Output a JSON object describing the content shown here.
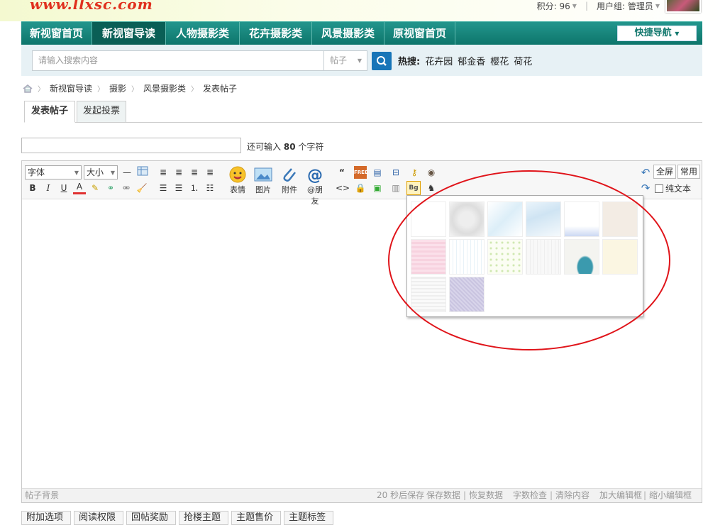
{
  "header": {
    "logo": "www.llxsc.com",
    "points_label": "积分: 96",
    "group_label": "用户组: 管理员"
  },
  "nav": {
    "items": [
      "新视窗首页",
      "新视窗导读",
      "人物摄影类",
      "花卉摄影类",
      "风景摄影类",
      "原视窗首页"
    ],
    "quick": "快捷导航"
  },
  "search": {
    "placeholder": "请输入搜索内容",
    "type": "帖子",
    "hot_label": "热搜:",
    "hot": [
      "花卉园",
      "郁金香",
      "樱花",
      "荷花"
    ]
  },
  "breadcrumb": [
    "新视窗导读",
    "摄影",
    "风景摄影类",
    "发表帖子"
  ],
  "tabs": [
    "发表帖子",
    "发起投票"
  ],
  "title_hint": {
    "prefix": "还可输入",
    "count": "80",
    "suffix": "个字符"
  },
  "toolbar": {
    "font": "字体",
    "size": "大小",
    "big": [
      "表情",
      "图片",
      "附件",
      "@朋友"
    ],
    "fullscreen": "全屏",
    "common": "常用",
    "plaintext": "纯文本",
    "bg": "Bg",
    "free": "FREE"
  },
  "status": {
    "left": "帖子背景",
    "autosave": "20 秒后保存",
    "save": "保存数据",
    "restore": "恢复数据",
    "check": "字数检查",
    "clear": "清除内容",
    "enlarge": "加大编辑框",
    "shrink": "缩小编辑框"
  },
  "bottom_tabs": [
    "附加选项",
    "阅读权限",
    "回帖奖励",
    "抢楼主题",
    "主题售价",
    "主题标签"
  ],
  "colors": {
    "nav": "#128076",
    "accent": "#1775b8",
    "highlight": "#e0141a"
  }
}
